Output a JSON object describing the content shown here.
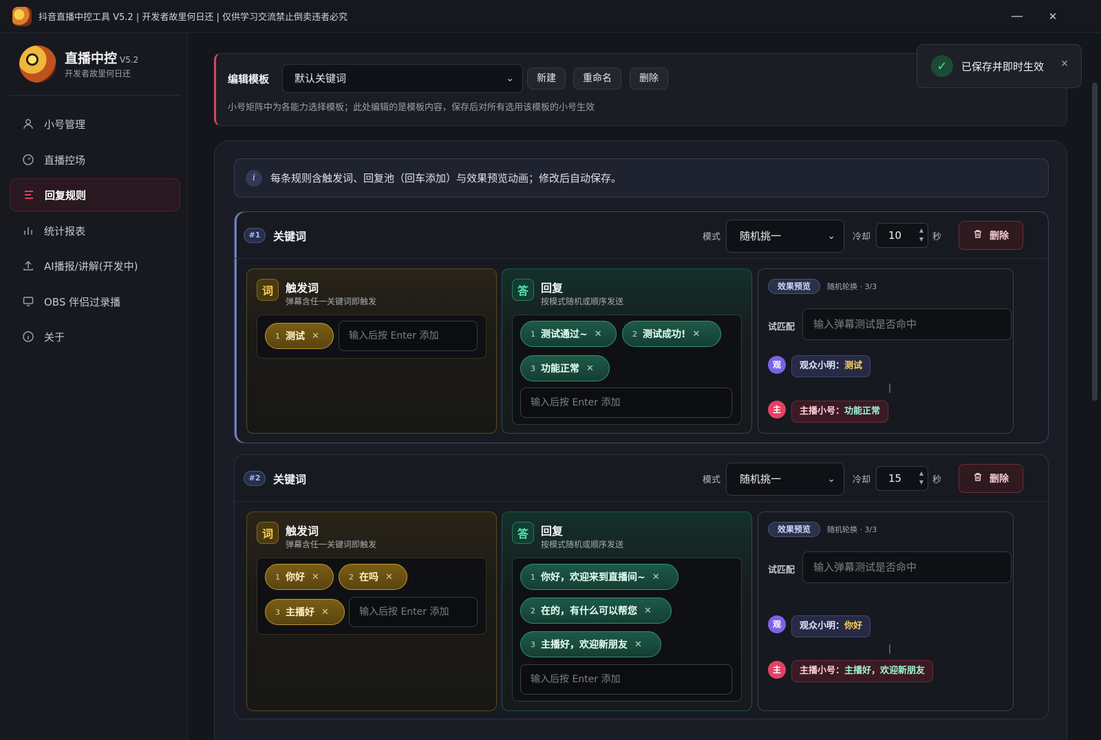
{
  "window": {
    "title": "抖音直播中控工具 V5.2 | 开发者故里何日还 | 仅供学习交流禁止倒卖违者必究",
    "minimize": "—",
    "close": "✕"
  },
  "brand": {
    "name": "直播中控",
    "version": "V5.2",
    "subtitle": "开发者故里何日还"
  },
  "nav": [
    {
      "label": "小号管理",
      "icon": "user-icon"
    },
    {
      "label": "直播控场",
      "icon": "gauge-icon"
    },
    {
      "label": "回复规则",
      "icon": "list-icon",
      "active": true
    },
    {
      "label": "统计报表",
      "icon": "bar-chart-icon"
    },
    {
      "label": "AI播报/讲解(开发中)",
      "icon": "upload-icon"
    },
    {
      "label": "OBS 伴侣过录播",
      "icon": "monitor-icon"
    },
    {
      "label": "关于",
      "icon": "info-icon"
    }
  ],
  "template": {
    "label": "编辑模板",
    "selected": "默认关键词",
    "new_label": "新建",
    "rename_label": "重命名",
    "delete_label": "删除",
    "hint": "小号矩阵中为各能力选择模板；此处编辑的是模板内容，保存后对所有选用该模板的小号生效"
  },
  "toast": {
    "text": "已保存并即时生效",
    "check": "✓",
    "close": "✕"
  },
  "info": {
    "icon": "i",
    "text": "每条规则含触发词、回复池（回车添加）与效果预览动画；修改后自动保存。"
  },
  "labels": {
    "mode": "模式",
    "cooldown": "冷却",
    "seconds": "秒",
    "delete": "删除",
    "trigger_badge": "词",
    "trigger_title": "触发词",
    "trigger_sub": "弹幕含任一关键词即触发",
    "reply_badge": "答",
    "reply_title": "回复",
    "reply_sub": "按模式随机或顺序发送",
    "input_placeholder": "输入后按 Enter 添加",
    "preview_tag": "效果预览",
    "try_label": "试匹配",
    "try_placeholder": "输入弹幕测试是否命中",
    "viewer_avatar": "观",
    "host_avatar": "主",
    "viewer_prefix": "观众小明：",
    "host_prefix": "主播小号："
  },
  "rules": [
    {
      "num": "#1",
      "type": "关键词",
      "mode": "随机挑一",
      "cooldown": "10",
      "triggers": [
        "测试"
      ],
      "replies": [
        "测试通过~",
        "测试成功!",
        "功能正常"
      ],
      "rotation": "随机轮换 · 3/3",
      "preview_viewer": "测试",
      "preview_host": "功能正常"
    },
    {
      "num": "#2",
      "type": "关键词",
      "mode": "随机挑一",
      "cooldown": "15",
      "triggers": [
        "你好",
        "在吗",
        "主播好"
      ],
      "replies": [
        "你好，欢迎来到直播间~",
        "在的，有什么可以帮您",
        "主播好，欢迎新朋友"
      ],
      "rotation": "随机轮换 · 3/3",
      "preview_viewer": "你好",
      "preview_host": "主播好，欢迎新朋友"
    }
  ]
}
